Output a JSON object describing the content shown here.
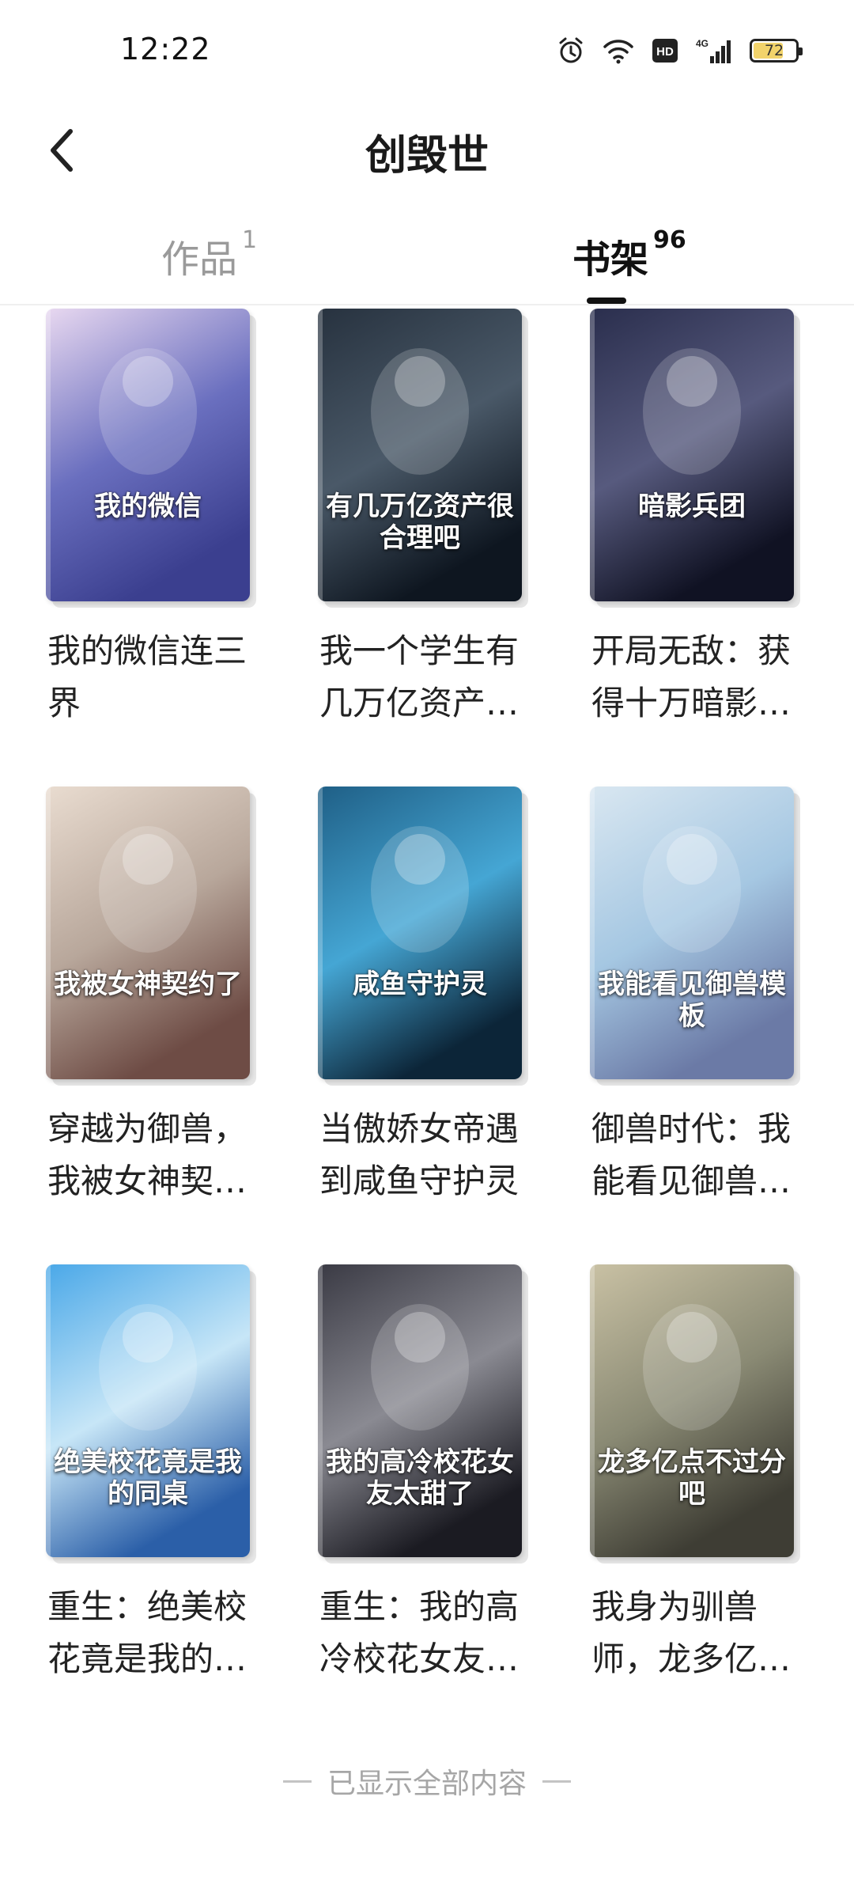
{
  "status": {
    "time": "12:22",
    "battery": "72",
    "network": "4G"
  },
  "header": {
    "title": "创毁世"
  },
  "tabs": [
    {
      "label": "作品",
      "count": "1",
      "active": false
    },
    {
      "label": "书架",
      "count": "96",
      "active": true
    }
  ],
  "books": [
    {
      "title": "我的微信连三界",
      "cover_text": "我的微信",
      "palette": [
        "#e8d8f0",
        "#6a6fbf",
        "#3b3f8f"
      ]
    },
    {
      "title": "我一个学生有几万亿资产很合理吧",
      "cover_text": "有几万亿资产很合理吧",
      "palette": [
        "#27323f",
        "#4a5968",
        "#0e1620"
      ]
    },
    {
      "title": "开局无敌：获得十万暗影兵团",
      "cover_text": "暗影兵团",
      "palette": [
        "#2a2e4d",
        "#575a7e",
        "#101223"
      ]
    },
    {
      "title": "穿越为御兽，我被女神契约了",
      "cover_text": "我被女神契约了",
      "palette": [
        "#e9dcd0",
        "#b8a79b",
        "#6e4c45"
      ]
    },
    {
      "title": "当傲娇女帝遇到咸鱼守护灵",
      "cover_text": "咸鱼守护灵",
      "palette": [
        "#1f5f86",
        "#45a6d4",
        "#0c2538"
      ]
    },
    {
      "title": "御兽时代：我能看见御兽模板",
      "cover_text": "我能看见御兽模板",
      "palette": [
        "#d9e7f1",
        "#a5c7e2",
        "#6b7aa6"
      ]
    },
    {
      "title": "重生：绝美校花竟是我的同桌",
      "cover_text": "绝美校花竟是我的同桌",
      "palette": [
        "#4aa8e8",
        "#c7e6f7",
        "#2b5fa8"
      ]
    },
    {
      "title": "重生：我的高冷校花女友太甜了",
      "cover_text": "我的高冷校花女友太甜了",
      "palette": [
        "#3a3a44",
        "#8a8a92",
        "#1b1b22"
      ]
    },
    {
      "title": "我身为驯兽师，龙多亿点不过分吧",
      "cover_text": "龙多亿点不过分吧",
      "palette": [
        "#c9c1a4",
        "#8a8a74",
        "#3e3d34"
      ]
    }
  ],
  "footer": {
    "text": "已显示全部内容"
  }
}
